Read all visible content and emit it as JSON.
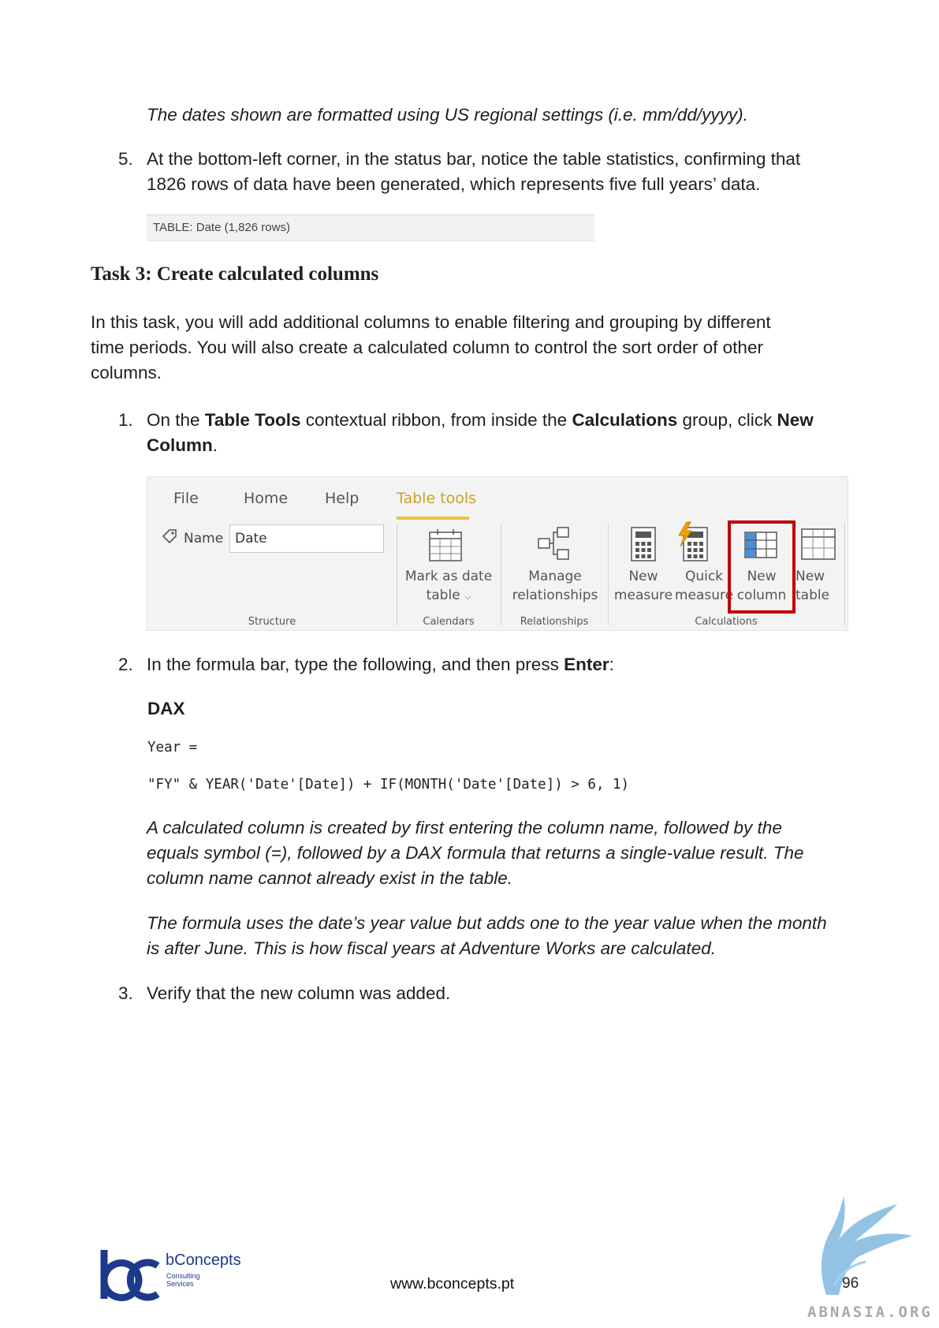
{
  "note_dates": "The dates shown are formatted using US regional settings (i.e. mm/dd/yyyy).",
  "step5": {
    "number": "5.",
    "line1": "At the bottom-left corner, in the status bar, notice the table statistics, confirming that",
    "line2": "1826 rows of data have been generated, which represents five full years’ data."
  },
  "status_bar_text": "TABLE: Date (1,826 rows)",
  "task_heading": "Task 3: Create calculated columns",
  "intro": {
    "line1": "In this task, you will add additional columns to enable filtering and grouping by different",
    "line2": "time periods. You will also create a calculated column to control the sort order of other",
    "line3": "columns."
  },
  "step1": {
    "number": "1.",
    "part1": "On the ",
    "bold1": "Table Tools",
    "part2": " contextual ribbon, from inside the ",
    "bold2": "Calculations",
    "part3": " group, click ",
    "bold3": "New",
    "bold4": "Column",
    "part4": "."
  },
  "ribbon": {
    "tabs": [
      "File",
      "Home",
      "Help",
      "Table tools"
    ],
    "name_label": "Name",
    "name_value": "Date",
    "groups": [
      "Structure",
      "Calendars",
      "Relationships",
      "Calculations"
    ],
    "buttons": {
      "mark_date_table": [
        "Mark as date",
        "table"
      ],
      "manage_relationships": [
        "Manage",
        "relationships"
      ],
      "new_measure": [
        "New",
        "measure"
      ],
      "quick_measure": [
        "Quick",
        "measure"
      ],
      "new_column": [
        "New",
        "column"
      ],
      "new_table": [
        "New",
        "table"
      ]
    },
    "icons": {
      "tag": "tag-icon",
      "mark_date_table": "calendar-table-icon",
      "manage_relationships": "relationships-icon",
      "new_measure": "calculator-icon",
      "quick_measure": "lightning-calculator-icon",
      "new_column": "table-column-icon",
      "new_table": "table-icon"
    },
    "accent_color": "#c9a227",
    "highlight_color": "#c00000"
  },
  "step2": {
    "number": "2.",
    "part1": "In the formula bar, type the following, and then press ",
    "bold1": "Enter",
    "part2": ":"
  },
  "dax_label": "DAX",
  "code": {
    "line1": "Year =",
    "line2": "\"FY\" & YEAR('Date'[Date]) + IF(MONTH('Date'[Date]) > 6, 1)"
  },
  "note_calc": {
    "line1": "A calculated column is created by first entering the column name, followed by the",
    "line2": "equals symbol (=), followed by a DAX formula that returns a single-value result. The",
    "line3": "column name cannot already exist in the table."
  },
  "note_formula": {
    "line1": "The formula uses the date’s year value but adds one to the year value when the month",
    "line2": "is after June. This is how fiscal years at Adventure Works are calculated."
  },
  "step3": {
    "number": "3.",
    "text": "Verify that the new column was added."
  },
  "footer": {
    "brand": "bConcepts",
    "brand_sub1": "Consulting",
    "brand_sub2": "Services",
    "url": "www.bconcepts.pt",
    "page": "96",
    "watermark": "ABNASIA.ORG"
  }
}
